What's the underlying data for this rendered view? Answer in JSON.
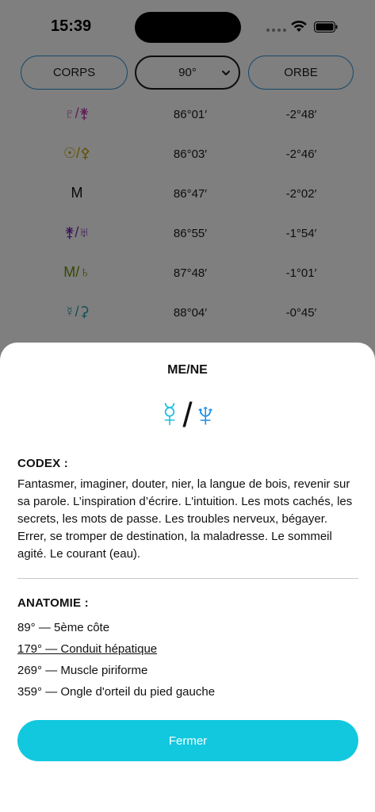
{
  "status_bar": {
    "time": "15:39"
  },
  "controls": {
    "corps_label": "CORPS",
    "angle_value": "90°",
    "orbe_label": "ORBE"
  },
  "aspects": [
    {
      "symbol": "♇/⚵",
      "symbol_color": "#c03fb0",
      "position": "86°01′",
      "orb": "-2°48′"
    },
    {
      "symbol": "☉/⚴",
      "symbol_color": "#c8a000",
      "position": "86°03′",
      "orb": "-2°46′"
    },
    {
      "symbol": "M",
      "symbol_color": "#111111",
      "position": "86°47′",
      "orb": "-2°02′"
    },
    {
      "symbol": "⚵/♅",
      "symbol_color": "#7b2fb5",
      "position": "86°55′",
      "orb": "-1°54′"
    },
    {
      "symbol": "M/♄",
      "symbol_color": "#6a8f00",
      "position": "87°48′",
      "orb": "-1°01′"
    },
    {
      "symbol": "☿/⚳",
      "symbol_color": "#2aa0a8",
      "position": "88°04′",
      "orb": "-0°45′"
    }
  ],
  "sheet": {
    "title": "ME/NE",
    "glyph_mercury": "☿",
    "glyph_separator": "/",
    "glyph_neptune": "♆",
    "codex_title": "CODEX :",
    "codex_text": "Fantasmer, imaginer, douter, nier, la langue de bois, revenir sur sa parole. L’inspiration d’écrire. L'intuition. Les mots cachés, les secrets, les mots de passe. Les troubles nerveux, bégayer. Errer, se tromper de destination, la maladresse. Le sommeil agité. Le courant (eau).",
    "anatomy_title": "ANATOMIE :",
    "anatomy_items": [
      {
        "label": "89° — 5ème côte",
        "linked": false
      },
      {
        "label": "179° — Conduit hépatique",
        "linked": true
      },
      {
        "label": "269° — Muscle piriforme",
        "linked": false
      },
      {
        "label": "359° — Ongle d'orteil du pied gauche",
        "linked": false
      }
    ],
    "close_label": "Fermer"
  },
  "colors": {
    "accent": "#12c8de",
    "outline": "#2a8fd6",
    "mercury": "#20bfe0",
    "neptune": "#1f8ee6"
  }
}
